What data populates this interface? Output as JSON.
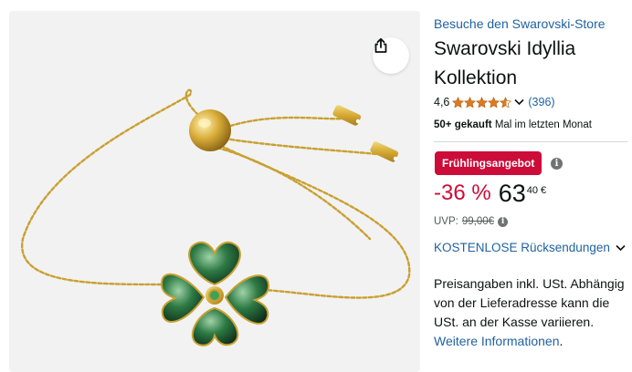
{
  "store_link": "Besuche den Swarovski-Store",
  "product": {
    "title": "Swarovski Idyllia Kollektion",
    "rating_value": "4,6",
    "rating_stars": 4.6,
    "review_count": "(396)",
    "bought_bold": "50+ gekauft",
    "bought_rest": "Mal im letzten Monat"
  },
  "deal": {
    "badge": "Frühlingsangebot",
    "badge_color": "#cc0c39"
  },
  "price": {
    "discount": "-36 %",
    "whole": "63",
    "fraction": "40 €",
    "uvp_label": "UVP:",
    "uvp_value": "99,00€"
  },
  "returns": {
    "label": "KOSTENLOSE Rücksendungen"
  },
  "tax_note": {
    "text": "Preisangaben inkl. USt. Abhängig von der Lieferadresse kann die USt. an der Kasse variieren.",
    "link": "Weitere Informationen",
    "tail": "."
  },
  "icons": {
    "share": "share-icon",
    "info": "i",
    "star_color": "#de7921",
    "link_color": "#2162a1"
  }
}
